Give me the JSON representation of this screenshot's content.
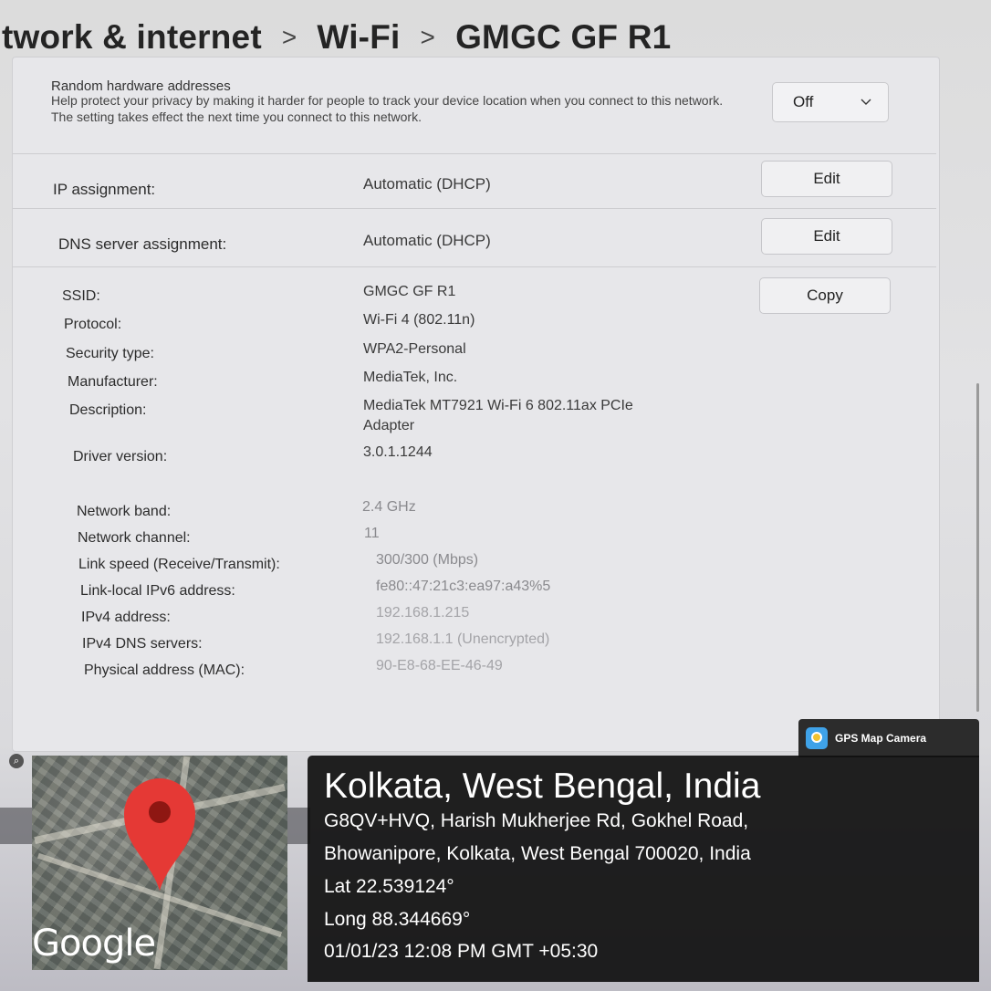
{
  "breadcrumb": {
    "items": [
      "twork & internet",
      "Wi-Fi",
      "GMGC GF R1"
    ],
    "separator": ">"
  },
  "random_hw": {
    "title": "Random hardware addresses",
    "description": "Help protect your privacy by making it harder for people to track your device location when you connect to this network. The setting takes effect the next time you connect to this network.",
    "value": "Off"
  },
  "ip_assignment": {
    "label": "IP assignment:",
    "value": "Automatic (DHCP)",
    "button": "Edit"
  },
  "dns_assignment": {
    "label": "DNS server assignment:",
    "value": "Automatic (DHCP)",
    "button": "Edit"
  },
  "copy_button": "Copy",
  "properties": [
    {
      "label": "SSID:",
      "value": "GMGC GF R1"
    },
    {
      "label": "Protocol:",
      "value": "Wi-Fi 4 (802.11n)"
    },
    {
      "label": "Security type:",
      "value": "WPA2-Personal"
    },
    {
      "label": "Manufacturer:",
      "value": "MediaTek, Inc."
    },
    {
      "label": "Description:",
      "value": "MediaTek MT7921 Wi-Fi 6 802.11ax PCIe",
      "value2": "Adapter"
    },
    {
      "label": "Driver version:",
      "value": "3.0.1.1244"
    },
    {
      "label": "Network band:",
      "value": "2.4 GHz"
    },
    {
      "label": "Network channel:",
      "value": "11"
    },
    {
      "label": "Link speed (Receive/Transmit):",
      "value": "300/300 (Mbps)"
    },
    {
      "label": "Link-local IPv6 address:",
      "value": "fe80::47:21c3:ea97:a43%5"
    },
    {
      "label": "IPv4 address:",
      "value": "192.168.1.215"
    },
    {
      "label": "IPv4 DNS servers:",
      "value": "192.168.1.1 (Unencrypted)"
    },
    {
      "label": "Physical address (MAC):",
      "value": "90-E8-68-EE-46-49"
    }
  ],
  "gps": {
    "app_name": "GPS Map Camera",
    "city": "Kolkata, West Bengal, India",
    "address_line1": "G8QV+HVQ, Harish Mukherjee Rd, Gokhel Road,",
    "address_line2": "Bhowanipore, Kolkata, West Bengal 700020, India",
    "lat": "Lat 22.539124°",
    "long": "Long 88.344669°",
    "timestamp": "01/01/23 12:08 PM GMT +05:30",
    "map_label": "Google"
  },
  "icons": {
    "chevron": "chevron-down-icon",
    "pin": "map-pin-icon",
    "gps_logo": "gps-map-camera-logo"
  },
  "colors": {
    "pin": "#e53935",
    "overlay": "#0f0f0f"
  }
}
